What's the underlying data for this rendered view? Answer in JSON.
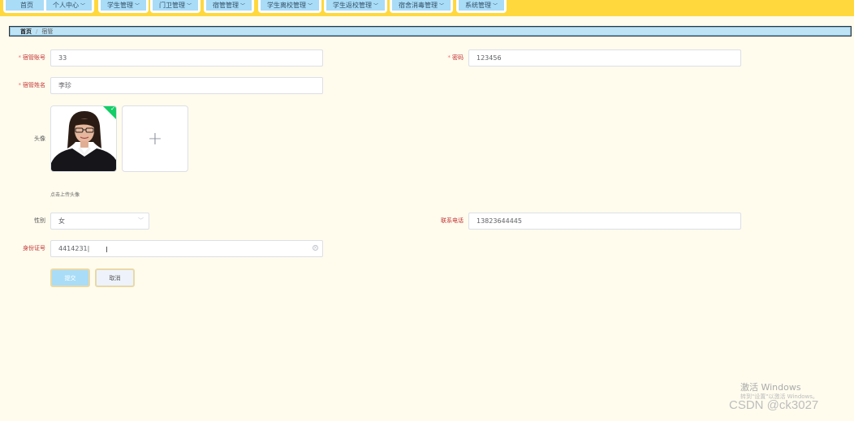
{
  "nav": {
    "items": [
      {
        "label": "首页",
        "dropdown": false
      },
      {
        "label": "个人中心",
        "dropdown": true
      },
      {
        "label": "学生管理",
        "dropdown": true
      },
      {
        "label": "门卫管理",
        "dropdown": true
      },
      {
        "label": "宿管管理",
        "dropdown": true
      },
      {
        "label": "学生离校管理",
        "dropdown": true
      },
      {
        "label": "学生返校管理",
        "dropdown": true
      },
      {
        "label": "宿舍消毒管理",
        "dropdown": true
      },
      {
        "label": "系统管理",
        "dropdown": true
      }
    ]
  },
  "breadcrumb": {
    "home": "首页",
    "separator": "/",
    "current": "宿管"
  },
  "form": {
    "account": {
      "label": "宿管账号",
      "value": "33"
    },
    "password": {
      "label": "密码",
      "value": "123456"
    },
    "name": {
      "label": "宿管姓名",
      "value": "李珍"
    },
    "avatar": {
      "label": "头像",
      "hint": "点击上传头像"
    },
    "gender": {
      "label": "性别",
      "value": "女"
    },
    "phone": {
      "label": "联系电话",
      "value": "13823644445"
    },
    "id_number": {
      "label": "身份证号",
      "value": "4414231"
    }
  },
  "buttons": {
    "submit": "提交",
    "cancel": "取消"
  },
  "watermark": {
    "line1": "激活 Windows",
    "line2": "转到\"设置\"以激活 Windows。",
    "line3": "CSDN @ck3027"
  },
  "colors": {
    "nav_bg": "#ffd83d",
    "page_bg": "#fffcee",
    "button_primary": "#a9dcf7",
    "success_badge": "#13ce66"
  }
}
